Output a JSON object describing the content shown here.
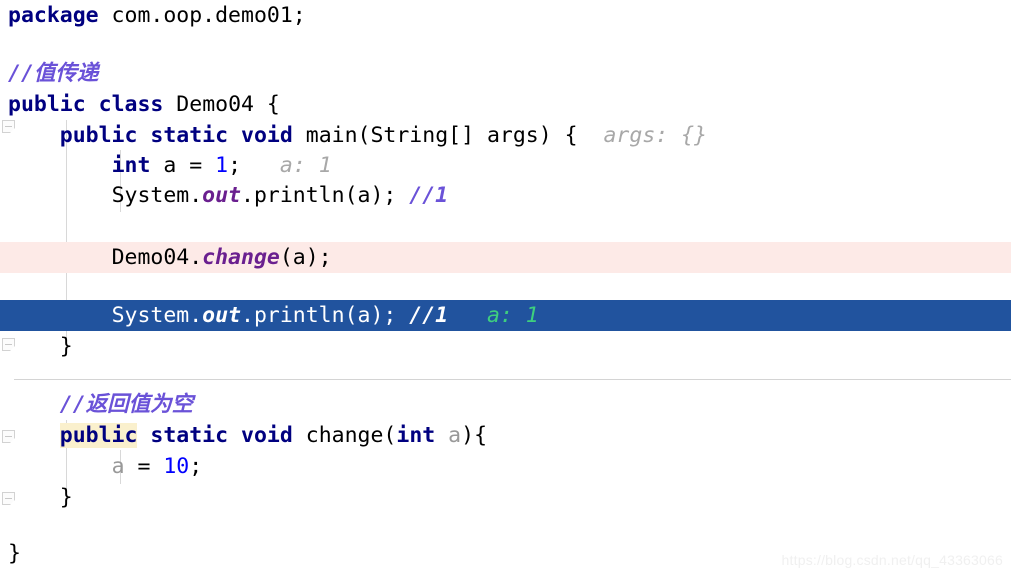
{
  "editor": {
    "language": "java",
    "watermark": "https://blog.csdn.net/qq_43363066",
    "colors": {
      "selection_background": "#21539e",
      "caret_row_background": "#fdeae7",
      "keyword": "#000080",
      "number": "#0000ff",
      "comment": "#6a52d8",
      "static_field": "#6a1f8f",
      "inline_hint": "#a8a8a8",
      "inline_hint_selected": "#3ecf7e",
      "identifier_highlight": "#faf0cd",
      "background": "#ffffff"
    }
  },
  "code": {
    "line1": {
      "keyword": "package",
      "rest": " com.oop.demo01;"
    },
    "line3": {
      "comment": "//值传递"
    },
    "line4": {
      "kw_public": "public",
      "space1": " ",
      "kw_class": "class",
      "rest": " Demo04 {"
    },
    "line5": {
      "indent": "    ",
      "kw_public": "public",
      "space1": " ",
      "kw_static": "static",
      "space2": " ",
      "kw_void": "void",
      "rest": " main(String[] args) {",
      "hint": "  args: {}"
    },
    "line6": {
      "indent": "        ",
      "kw_int": "int",
      "mid": " a = ",
      "num": "1",
      "semi": ";",
      "hint": "   a: 1"
    },
    "line7": {
      "indent": "        ",
      "pre": "System.",
      "field": "out",
      "post": ".println(a); ",
      "comment": "//1"
    },
    "line9": {
      "indent": "        ",
      "pre": "Demo04.",
      "method": "change",
      "post": "(a);"
    },
    "line11": {
      "indent": "        ",
      "pre": "System.",
      "field": "out",
      "post": ".println(a); ",
      "comment": "//1",
      "hint": "   a: 1"
    },
    "line12": {
      "indent": "    ",
      "brace": "}"
    },
    "line14": {
      "indent": "    ",
      "comment": "//返回值为空"
    },
    "line15": {
      "indent": "    ",
      "kw_public": "public",
      "space1": " ",
      "kw_static": "static",
      "space2": " ",
      "kw_void": "void",
      "mid": " change(",
      "kw_int": "int",
      "space3": " ",
      "param": "a",
      "post": "){"
    },
    "line16": {
      "indent": "        ",
      "param": "a",
      "mid": " = ",
      "num": "10",
      "semi": ";"
    },
    "line17": {
      "indent": "    ",
      "brace": "}"
    },
    "line19": {
      "brace": "}"
    }
  }
}
